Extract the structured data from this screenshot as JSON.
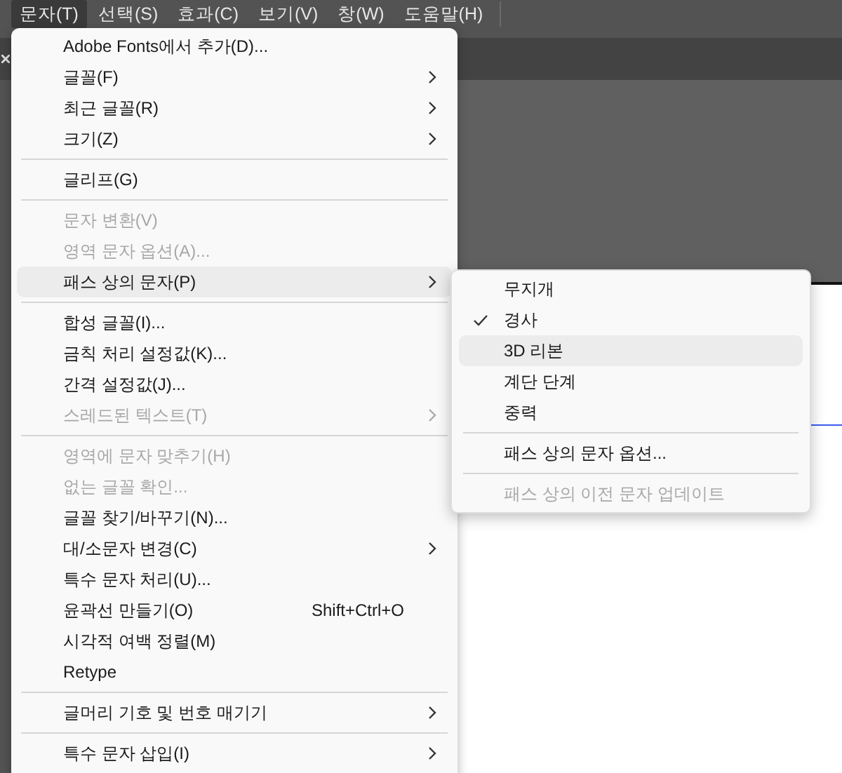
{
  "menubar": [
    {
      "label": "문자(T)",
      "selected": true
    },
    {
      "label": "선택(S)",
      "selected": false
    },
    {
      "label": "효과(C)",
      "selected": false
    },
    {
      "label": "보기(V)",
      "selected": false
    },
    {
      "label": "창(W)",
      "selected": false
    },
    {
      "label": "도움말(H)",
      "selected": false
    }
  ],
  "menu": {
    "items": [
      {
        "kind": "item",
        "label": "Adobe Fonts에서 추가(D)...",
        "disabled": false,
        "submenu": false,
        "selected": false
      },
      {
        "kind": "item",
        "label": "글꼴(F)",
        "disabled": false,
        "submenu": true,
        "selected": false
      },
      {
        "kind": "item",
        "label": "최근 글꼴(R)",
        "disabled": false,
        "submenu": true,
        "selected": false
      },
      {
        "kind": "item",
        "label": "크기(Z)",
        "disabled": false,
        "submenu": true,
        "selected": false
      },
      {
        "kind": "separator"
      },
      {
        "kind": "item",
        "label": "글리프(G)",
        "disabled": false,
        "submenu": false,
        "selected": false
      },
      {
        "kind": "separator"
      },
      {
        "kind": "item",
        "label": "문자 변환(V)",
        "disabled": true,
        "submenu": false,
        "selected": false
      },
      {
        "kind": "item",
        "label": "영역 문자 옵션(A)...",
        "disabled": true,
        "submenu": false,
        "selected": false
      },
      {
        "kind": "item",
        "label": "패스 상의 문자(P)",
        "disabled": false,
        "submenu": true,
        "selected": true
      },
      {
        "kind": "separator"
      },
      {
        "kind": "item",
        "label": "합성 글꼴(I)...",
        "disabled": false,
        "submenu": false,
        "selected": false
      },
      {
        "kind": "item",
        "label": "금칙 처리 설정값(K)...",
        "disabled": false,
        "submenu": false,
        "selected": false
      },
      {
        "kind": "item",
        "label": "간격 설정값(J)...",
        "disabled": false,
        "submenu": false,
        "selected": false
      },
      {
        "kind": "item",
        "label": "스레드된 텍스트(T)",
        "disabled": true,
        "submenu": true,
        "selected": false
      },
      {
        "kind": "separator"
      },
      {
        "kind": "item",
        "label": "영역에 문자 맞추기(H)",
        "disabled": true,
        "submenu": false,
        "selected": false
      },
      {
        "kind": "item",
        "label": "없는 글꼴 확인...",
        "disabled": true,
        "submenu": false,
        "selected": false
      },
      {
        "kind": "item",
        "label": "글꼴 찾기/바꾸기(N)...",
        "disabled": false,
        "submenu": false,
        "selected": false
      },
      {
        "kind": "item",
        "label": "대/소문자 변경(C)",
        "disabled": false,
        "submenu": true,
        "selected": false
      },
      {
        "kind": "item",
        "label": "특수 문자 처리(U)...",
        "disabled": false,
        "submenu": false,
        "selected": false
      },
      {
        "kind": "item",
        "label": "윤곽선 만들기(O)",
        "shortcut": "Shift+Ctrl+O",
        "disabled": false,
        "submenu": false,
        "selected": false
      },
      {
        "kind": "item",
        "label": "시각적 여백 정렬(M)",
        "disabled": false,
        "submenu": false,
        "selected": false
      },
      {
        "kind": "item",
        "label": "Retype",
        "disabled": false,
        "submenu": false,
        "selected": false
      },
      {
        "kind": "separator"
      },
      {
        "kind": "item",
        "label": "글머리 기호 및 번호 매기기",
        "disabled": false,
        "submenu": true,
        "selected": false
      },
      {
        "kind": "separator"
      },
      {
        "kind": "item",
        "label": "특수 문자 삽입(I)",
        "disabled": false,
        "submenu": true,
        "selected": false
      }
    ]
  },
  "submenu": {
    "items": [
      {
        "kind": "item",
        "label": "무지개",
        "checked": false,
        "selected": false,
        "disabled": false
      },
      {
        "kind": "item",
        "label": "경사",
        "checked": true,
        "selected": false,
        "disabled": false
      },
      {
        "kind": "item",
        "label": "3D 리본",
        "checked": false,
        "selected": true,
        "disabled": false
      },
      {
        "kind": "item",
        "label": "계단 단계",
        "checked": false,
        "selected": false,
        "disabled": false
      },
      {
        "kind": "item",
        "label": "중력",
        "checked": false,
        "selected": false,
        "disabled": false
      },
      {
        "kind": "separator"
      },
      {
        "kind": "item",
        "label": "패스 상의 문자 옵션...",
        "checked": false,
        "selected": false,
        "disabled": false
      },
      {
        "kind": "separator"
      },
      {
        "kind": "item",
        "label": "패스 상의 이전 문자 업데이트",
        "checked": false,
        "selected": false,
        "disabled": true
      }
    ]
  }
}
